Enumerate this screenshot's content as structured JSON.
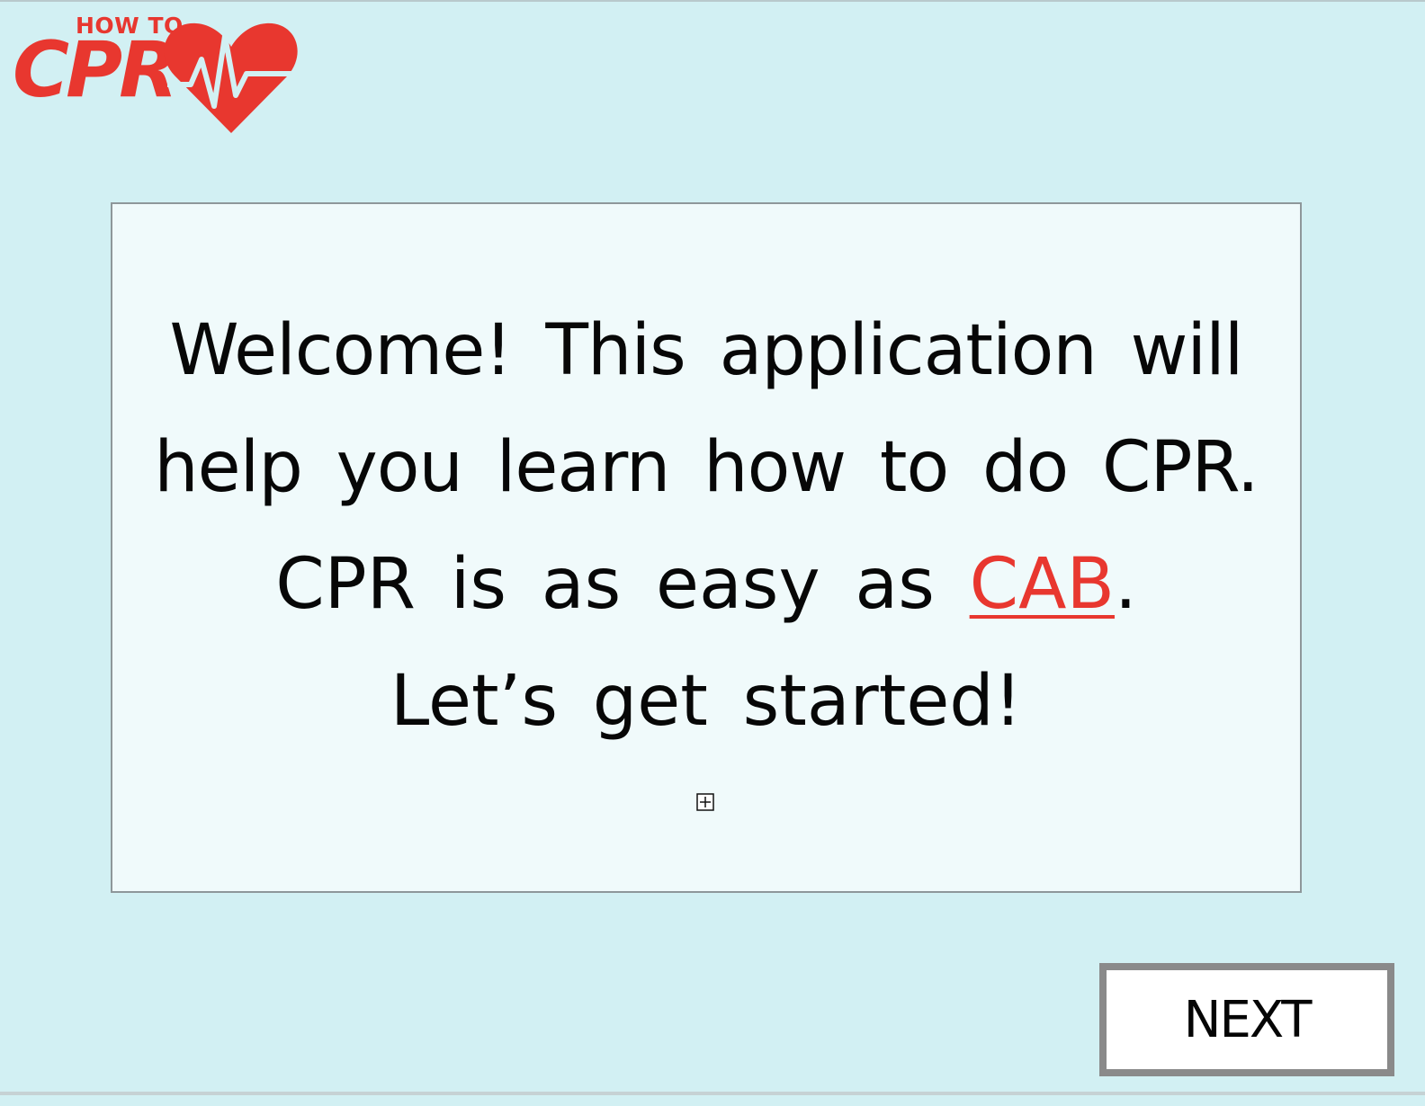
{
  "app": {
    "logo": {
      "small_text": "HOW TO",
      "big_text": "CPR",
      "icon": "heart-heartbeat-icon"
    }
  },
  "welcome": {
    "line1": "Welcome! This application will",
    "line2": "help you learn how to do CPR.",
    "line3_prefix": "CPR is as easy as ",
    "line3_link": "CAB",
    "line3_suffix": ".",
    "line4": "Let’s get started!"
  },
  "controls": {
    "expand_icon": "plus-box-icon",
    "next_label": "NEXT"
  },
  "colors": {
    "background": "#d2f0f3",
    "panel": "#f0fafb",
    "accent_red": "#e8372f",
    "button_border": "#8a8a8a"
  }
}
